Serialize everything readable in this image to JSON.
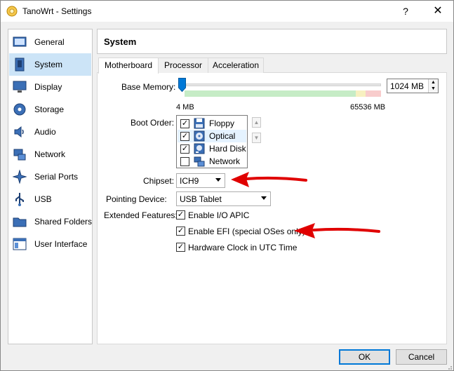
{
  "window": {
    "title": "TanoWrt - Settings",
    "help_label": "?",
    "close_label": "✕"
  },
  "sidebar": {
    "items": [
      {
        "label": "General",
        "icon": "general-icon"
      },
      {
        "label": "System",
        "icon": "system-icon",
        "selected": true
      },
      {
        "label": "Display",
        "icon": "display-icon"
      },
      {
        "label": "Storage",
        "icon": "storage-icon"
      },
      {
        "label": "Audio",
        "icon": "audio-icon"
      },
      {
        "label": "Network",
        "icon": "network-icon"
      },
      {
        "label": "Serial Ports",
        "icon": "serial-ports-icon"
      },
      {
        "label": "USB",
        "icon": "usb-icon"
      },
      {
        "label": "Shared Folders",
        "icon": "shared-folders-icon"
      },
      {
        "label": "User Interface",
        "icon": "user-interface-icon"
      }
    ]
  },
  "header": {
    "title": "System"
  },
  "tabs": [
    {
      "label": "Motherboard",
      "active": true
    },
    {
      "label": "Processor"
    },
    {
      "label": "Acceleration"
    }
  ],
  "motherboard": {
    "base_memory_label": "Base Memory:",
    "base_memory_value": "1024 MB",
    "base_memory_fraction": 0.0156,
    "memory_min": "4 MB",
    "memory_max": "65536 MB",
    "boot_order_label": "Boot Order:",
    "boot_order": [
      {
        "label": "Floppy",
        "checked": true,
        "icon": "floppy-icon"
      },
      {
        "label": "Optical",
        "checked": true,
        "icon": "optical-icon",
        "selected": true
      },
      {
        "label": "Hard Disk",
        "checked": true,
        "icon": "hard-disk-icon"
      },
      {
        "label": "Network",
        "checked": false,
        "icon": "network-boot-icon"
      }
    ],
    "move_up": "▲",
    "move_down": "▼",
    "chipset_label": "Chipset:",
    "chipset_value": "ICH9",
    "pointing_label": "Pointing Device:",
    "pointing_value": "USB Tablet",
    "extended_label": "Extended Features:",
    "features": [
      {
        "label": "Enable I/O APIC",
        "checked": true
      },
      {
        "label": "Enable EFI (special OSes only)",
        "checked": true
      },
      {
        "label": "Hardware Clock in UTC Time",
        "checked": true
      }
    ]
  },
  "buttons": {
    "ok": "OK",
    "cancel": "Cancel"
  },
  "colors": {
    "selection": "#cce4f7",
    "accent": "#0078d7",
    "annotation_arrow": "#e00000"
  }
}
